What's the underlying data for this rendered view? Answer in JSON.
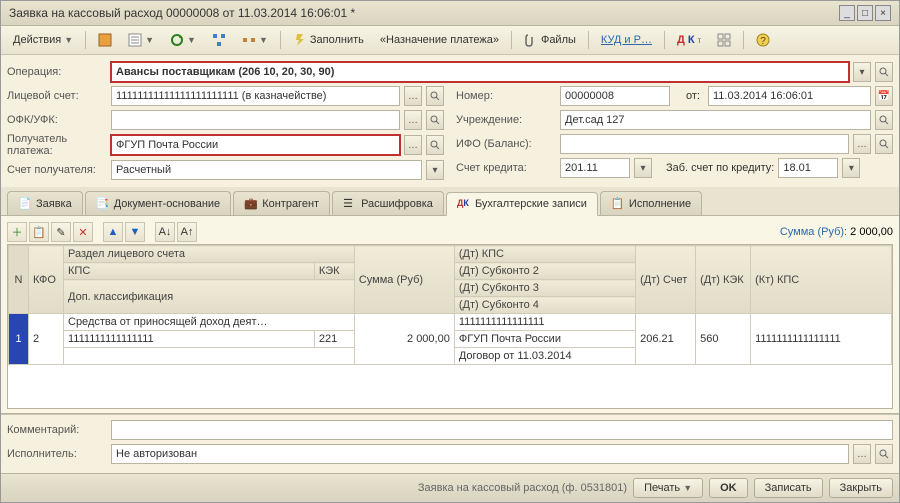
{
  "window": {
    "title": "Заявка на кассовый расход 00000008 от 11.03.2014 16:06:01 *"
  },
  "toolbar": {
    "actions": "Действия",
    "fill": "Заполнить",
    "payment_purpose": "«Назначение платежа»",
    "files": "Файлы",
    "kud": "КУД и Р…"
  },
  "form": {
    "operation_label": "Операция:",
    "operation_value": "Авансы поставщикам  (206 10, 20, 30, 90)",
    "personal_account_label": "Лицевой счет:",
    "personal_account_value": "11111111111111111111111 (в казначействе)",
    "ofk_label": "ОФК/УФК:",
    "recipient_label": "Получатель платежа:",
    "recipient_value": "ФГУП Почта России",
    "recipient_account_label": "Счет получателя:",
    "recipient_account_value": "Расчетный",
    "number_label": "Номер:",
    "number_value": "00000008",
    "from_label": "от:",
    "date_value": "11.03.2014 16:06:01",
    "institution_label": "Учреждение:",
    "institution_value": "Дет.сад 127",
    "ifo_label": "ИФО (Баланс):",
    "credit_account_label": "Счет кредита:",
    "credit_account_value": "201.11",
    "offbalance_label": "Заб. счет по кредиту:",
    "offbalance_value": "18.01"
  },
  "tabs": {
    "application": "Заявка",
    "basis_document": "Документ-основание",
    "counterparty": "Контрагент",
    "decoding": "Расшифровка",
    "accounting": "Бухгалтерские записи",
    "execution": "Исполнение"
  },
  "grid": {
    "sum_label": "Сумма (Руб):",
    "sum_value": "2 000,00",
    "headers": {
      "n": "N",
      "kfo": "КФО",
      "section": "Раздел лицевого счета",
      "kps": "КПС",
      "kek": "КЭК",
      "dop": "Доп. классификация",
      "sum": "Сумма (Руб)",
      "dt_kps": "(Дт) КПС",
      "dt_sub2": "(Дт) Субконто 2",
      "dt_sub3": "(Дт) Субконто 3",
      "dt_sub4": "(Дт) Субконто 4",
      "dt_account": "(Дт) Счет",
      "dt_kek": "(Дт) КЭК",
      "kt_kps": "(Кт) КПС"
    },
    "rows": [
      {
        "n": "1",
        "kfo": "2",
        "section": "Средства от приносящей доход деят…",
        "kps": "1111111111111111",
        "kek": "221",
        "sum": "2 000,00",
        "dt_kps": "1111111111111111",
        "dt_sub2": "ФГУП Почта России",
        "dt_sub3": "Договор  от 11.03.2014",
        "dt_account": "206.21",
        "dt_kek": "560",
        "kt_kps": "1111111111111111"
      }
    ]
  },
  "bottom": {
    "comment_label": "Комментарий:",
    "executor_label": "Исполнитель:",
    "executor_value": "Не авторизован"
  },
  "status": {
    "form_name": "Заявка на кассовый расход (ф. 0531801)",
    "print": "Печать",
    "ok": "OK",
    "save": "Записать",
    "close": "Закрыть"
  }
}
